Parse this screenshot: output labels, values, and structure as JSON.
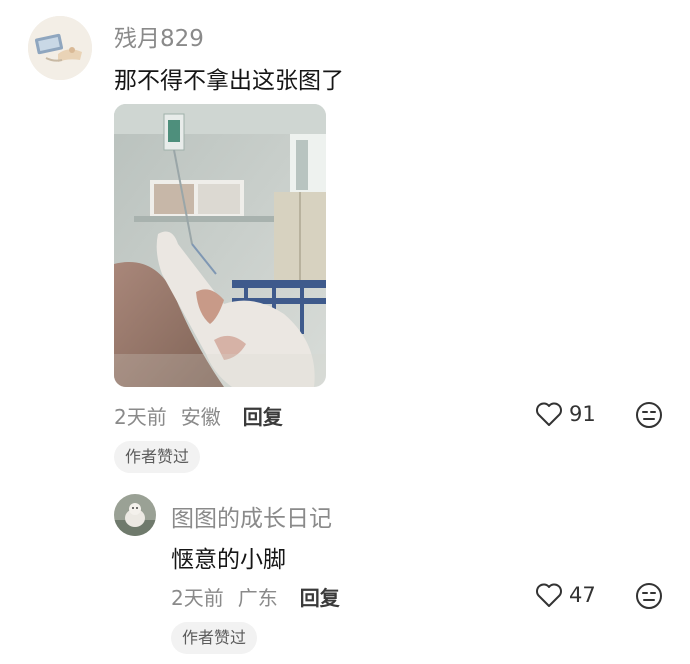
{
  "comments": [
    {
      "username": "残月829",
      "text": "那不得不拿出这张图了",
      "time": "2天前",
      "location": "安徽",
      "reply_label": "回复",
      "likes": "91",
      "author_liked_badge": "作者赞过"
    },
    {
      "username": "图图的成长日记",
      "text": "惬意的小脚",
      "time": "2天前",
      "location": "广东",
      "reply_label": "回复",
      "likes": "47",
      "author_liked_badge": "作者赞过"
    }
  ]
}
